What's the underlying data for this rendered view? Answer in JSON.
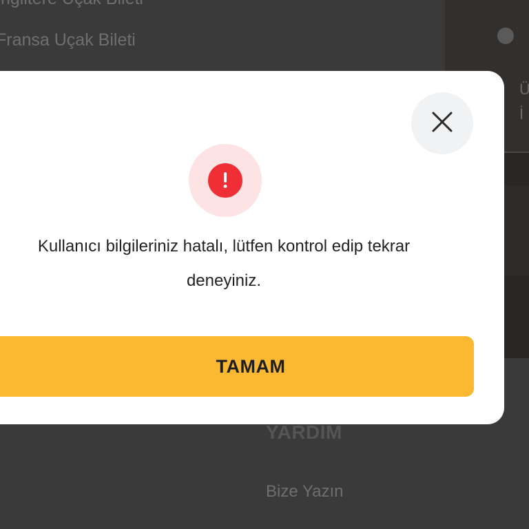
{
  "background": {
    "links": [
      "İngiltere Uçak Bileti",
      "Fransa Uçak Bileti"
    ],
    "footer_heading": "YARDIM",
    "footer_link": "Bize Yazın",
    "card_text": [
      "Ü",
      "İ"
    ]
  },
  "modal": {
    "message": "Kullanıcı bilgileriniz hatalı, lütfen kontrol edip tekrar deneyiniz.",
    "ok_label": "TAMAM",
    "close_icon": "close-icon",
    "alert_icon": "exclamation-icon",
    "colors": {
      "button": "#fbb933",
      "alert": "#ef2f35",
      "alert_halo": "#fde3e3"
    }
  }
}
